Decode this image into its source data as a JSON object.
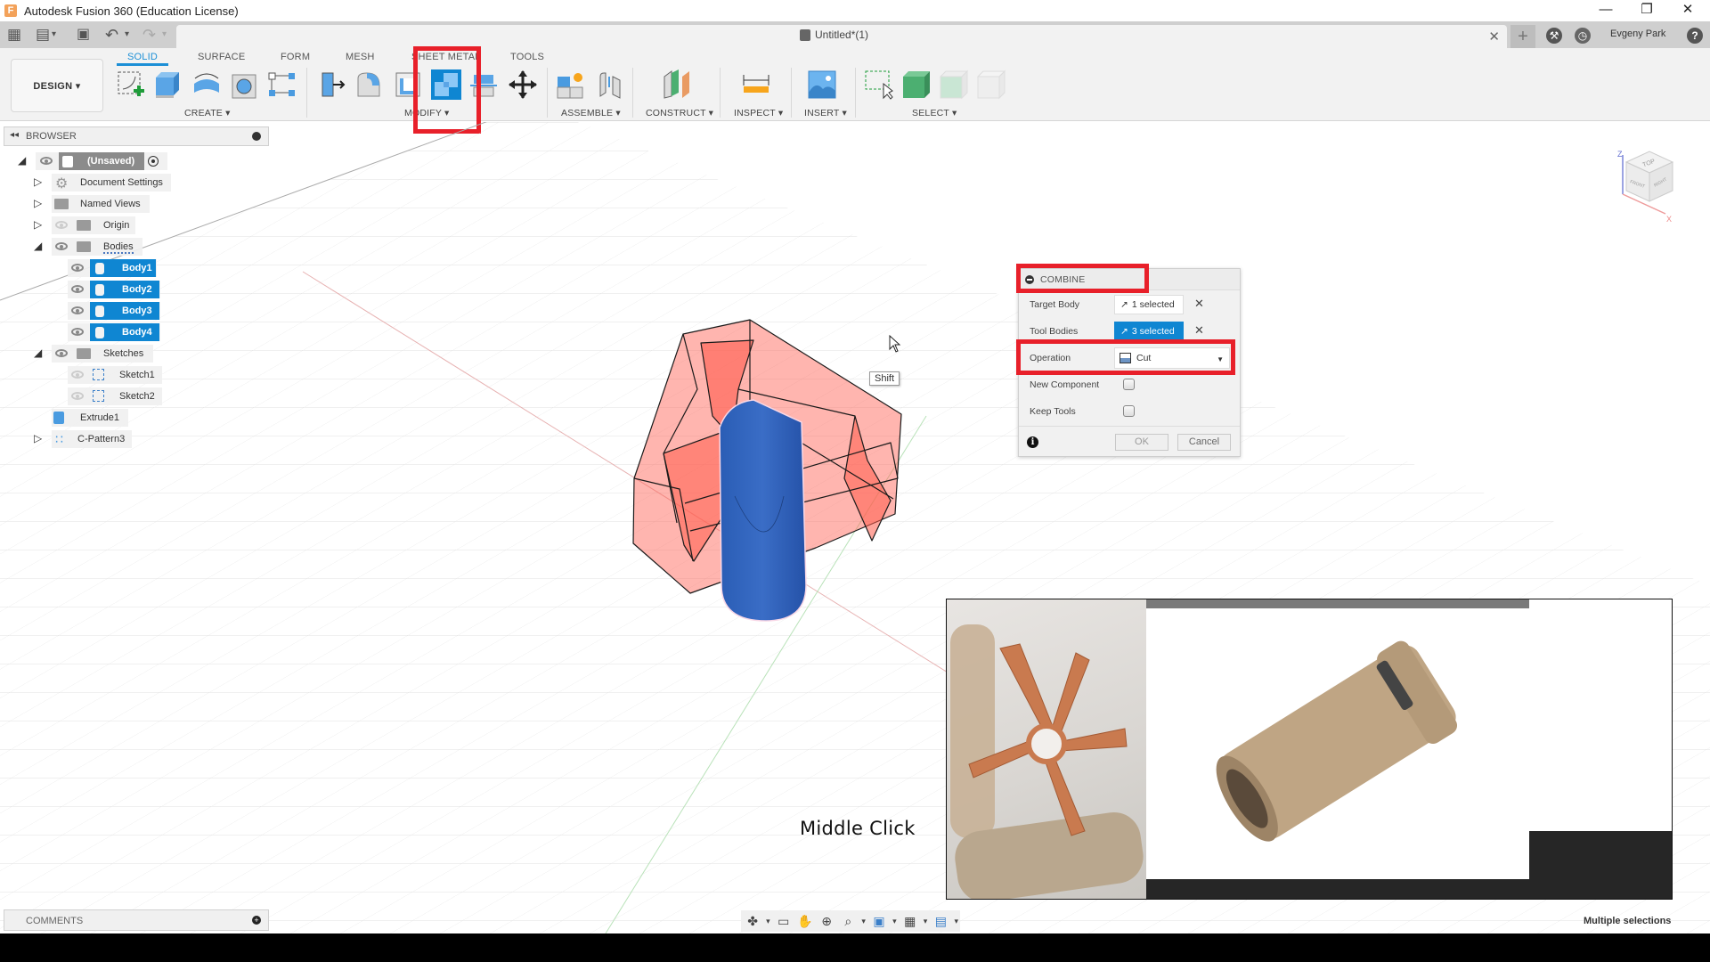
{
  "window": {
    "title": "Autodesk Fusion 360 (Education License)",
    "logo_letter": "F",
    "minimize": "—",
    "restore": "❐",
    "close": "✕"
  },
  "quick_access": {
    "grid_icon": "▦",
    "file_icon": "▤",
    "save_icon": "▣",
    "undo_icon": "↶",
    "redo_icon": "↷",
    "caret": "▾"
  },
  "document_tab": {
    "title": "Untitled*(1)",
    "close": "✕",
    "new_tab": "+"
  },
  "header_right": {
    "job_status_icon": "⚒",
    "notifications_icon": "◷",
    "user": "Evgeny Park",
    "help": "?"
  },
  "toolbar": {
    "workspace": "DESIGN ▾",
    "tabs": [
      {
        "label": "SOLID",
        "active": true
      },
      {
        "label": "SURFACE",
        "active": false
      },
      {
        "label": "FORM",
        "active": false
      },
      {
        "label": "MESH",
        "active": false
      },
      {
        "label": "SHEET METAL",
        "active": false
      },
      {
        "label": "TOOLS",
        "active": false
      }
    ],
    "groups": {
      "create": "CREATE ▾",
      "modify": "MODIFY ▾",
      "assemble": "ASSEMBLE ▾",
      "construct": "CONSTRUCT ▾",
      "inspect": "INSPECT ▾",
      "insert": "INSERT ▾",
      "select": "SELECT ▾"
    }
  },
  "browser": {
    "title": "BROWSER",
    "collapse": "◂◂",
    "root": "(Unsaved)",
    "items": [
      {
        "label": "Document Settings"
      },
      {
        "label": "Named Views"
      },
      {
        "label": "Origin"
      },
      {
        "label": "Bodies"
      },
      {
        "label": "Sketches"
      },
      {
        "label": "Sketch1"
      },
      {
        "label": "Sketch2"
      },
      {
        "label": "Extrude1"
      },
      {
        "label": "C-Pattern3"
      }
    ],
    "bodies": [
      "Body1",
      "Body2",
      "Body3",
      "Body4"
    ]
  },
  "combine_dialog": {
    "title": "COMBINE",
    "target_body_label": "Target Body",
    "target_body_value": "1 selected",
    "tool_bodies_label": "Tool Bodies",
    "tool_bodies_value": "3 selected",
    "operation_label": "Operation",
    "operation_value": "Cut",
    "new_component_label": "New Component",
    "new_component_checked": false,
    "keep_tools_label": "Keep Tools",
    "keep_tools_checked": false,
    "clear": "✕",
    "ok": "OK",
    "cancel": "Cancel",
    "info": "i"
  },
  "tooltip": "Shift",
  "overlay_caption": "Middle Click",
  "viewcube": {
    "top": "TOP",
    "front": "FRONT",
    "right": "RIGHT",
    "z": "Z",
    "x": "X"
  },
  "comments": {
    "title": "COMMENTS",
    "add": "+"
  },
  "navbar": {
    "orbit": "✤",
    "look_at": "▭",
    "pan": "✋",
    "zoom": "⊕",
    "fit": "⌕",
    "display": "▣",
    "grid": "▦",
    "viewports": "▤",
    "caret": "▾"
  },
  "status_text": "Multiple selections",
  "colors": {
    "accent": "#0f86d2",
    "highlight": "#e8202a",
    "tool_body_fill": "#ff5c4d",
    "target_body_fill": "#2a5db5"
  }
}
